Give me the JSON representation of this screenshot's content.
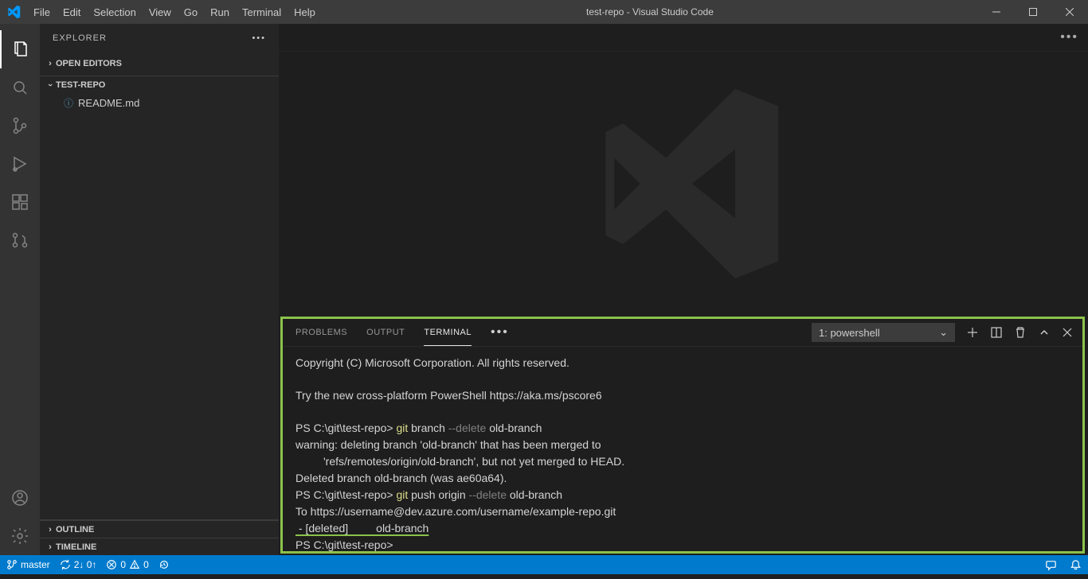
{
  "titlebar": {
    "menus": [
      "File",
      "Edit",
      "Selection",
      "View",
      "Go",
      "Run",
      "Terminal",
      "Help"
    ],
    "title": "test-repo - Visual Studio Code"
  },
  "sidebar": {
    "header": "EXPLORER",
    "open_editors": "OPEN EDITORS",
    "repo": "TEST-REPO",
    "files": [
      {
        "name": "README.md"
      }
    ],
    "outline": "OUTLINE",
    "timeline": "TIMELINE"
  },
  "panel": {
    "tabs": {
      "problems": "PROBLEMS",
      "output": "OUTPUT",
      "terminal": "TERMINAL"
    },
    "select": "1: powershell"
  },
  "terminal": {
    "l1": "Copyright (C) Microsoft Corporation. All rights reserved.",
    "l2": "Try the new cross-platform PowerShell https://aka.ms/pscore6",
    "p1": "PS C:\\git\\test-repo> ",
    "c1a": "git",
    "c1b": " branch ",
    "c1c": "--delete",
    "c1d": " old-branch",
    "l3": "warning: deleting branch 'old-branch' that has been merged to",
    "l4": "         'refs/remotes/origin/old-branch', but not yet merged to HEAD.",
    "l5": "Deleted branch old-branch (was ae60a64).",
    "p2": "PS C:\\git\\test-repo> ",
    "c2a": "git",
    "c2b": " push origin ",
    "c2c": "--delete",
    "c2d": " old-branch",
    "l6": "To https://username@dev.azure.com/username/example-repo.git",
    "l7": " - [deleted]         old-branch",
    "p3": "PS C:\\git\\test-repo>"
  },
  "statusbar": {
    "branch": "master",
    "sync": "2↓ 0↑",
    "errors": "0",
    "warnings": "0"
  }
}
